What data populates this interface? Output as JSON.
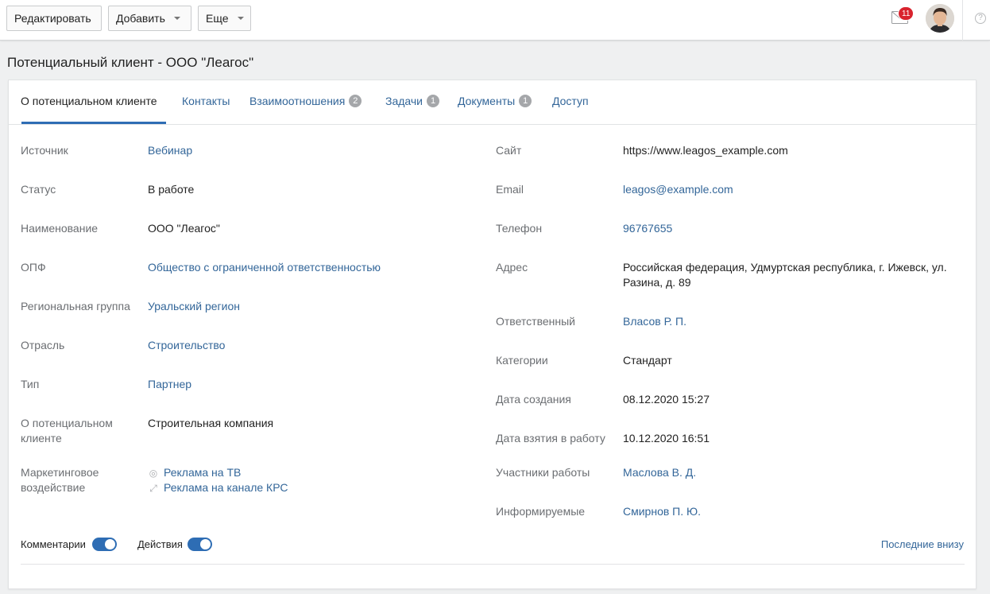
{
  "toolbar": {
    "edit_label": "Редактировать",
    "add_label": "Добавить",
    "more_label": "Еще",
    "mail_count": "11",
    "help_glyph": "?"
  },
  "page": {
    "title": "Потенциальный клиент - ООО \"Леагос\""
  },
  "tabs": [
    {
      "label": "О потенциальном клиенте",
      "count": "",
      "active": true
    },
    {
      "label": "Контакты",
      "count": ""
    },
    {
      "label": "Взаимоотношения",
      "count": "2"
    },
    {
      "label": "Задачи",
      "count": "1"
    },
    {
      "label": "Документы",
      "count": "1"
    },
    {
      "label": "Доступ",
      "count": ""
    }
  ],
  "left_fields": {
    "source": {
      "label": "Источник",
      "value": "Вебинар"
    },
    "status": {
      "label": "Статус",
      "value": "В работе"
    },
    "name": {
      "label": "Наименование",
      "value": "ООО \"Леагос\""
    },
    "opf": {
      "label": "ОПФ",
      "value": "Общество с ограниченной ответственностью"
    },
    "region_group": {
      "label": "Региональная группа",
      "value": "Уральский регион"
    },
    "industry": {
      "label": "Отрасль",
      "value": "Строительство"
    },
    "type": {
      "label": "Тип",
      "value": "Партнер"
    },
    "about": {
      "label_line1": "О потенциальном",
      "label_line2": "клиенте",
      "value": "Строительная компания"
    },
    "marketing": {
      "label_line1": "Маркетинговое",
      "label_line2": "воздействие",
      "items": [
        {
          "icon": "target-icon",
          "text": "Реклама на ТВ"
        },
        {
          "icon": "resize-arrow-icon",
          "text": "Реклама на канале КРС"
        }
      ]
    }
  },
  "right_fields": {
    "site": {
      "label": "Сайт",
      "value": "https://www.leagos_example.com"
    },
    "email": {
      "label": "Email",
      "value": "leagos@example.com"
    },
    "phone": {
      "label": "Телефон",
      "value": "96767655"
    },
    "address": {
      "label": "Адрес",
      "value_line1": "Российская федерация, Удмуртская республика, г. Ижевск, ул.",
      "value_line2": "Разина, д. 89"
    },
    "responsible": {
      "label": "Ответственный",
      "value": "Власов Р. П."
    },
    "categories": {
      "label": "Категории",
      "value": "Стандарт"
    },
    "created": {
      "label": "Дата создания",
      "value": "08.12.2020 15:27"
    },
    "taken": {
      "label": "Дата взятия в работу",
      "value": "10.12.2020 16:51"
    },
    "participants": {
      "label": "Участники работы",
      "value": "Маслова В. Д."
    },
    "informed": {
      "label": "Информируемые",
      "value": "Смирнов П. Ю."
    }
  },
  "feed": {
    "comments_label": "Комментарии",
    "comments_on": true,
    "actions_label": "Действия",
    "actions_on": true,
    "order_link": "Последние внизу"
  },
  "colors": {
    "accent": "#2e6db4",
    "link": "#336699",
    "badge": "#d9232e"
  }
}
